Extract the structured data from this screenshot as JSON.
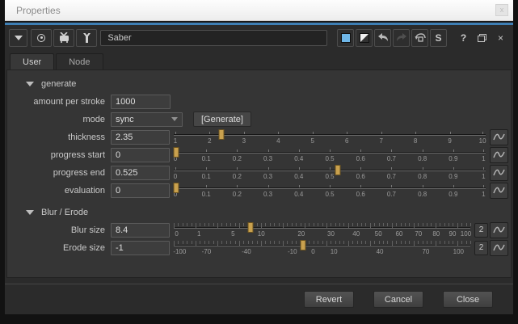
{
  "window": {
    "title": "Properties"
  },
  "toolbar": {
    "node_name": "Saber",
    "s_button_label": "S",
    "help_label": "?",
    "close_label": "×"
  },
  "tabs": {
    "user": "User",
    "node": "Node"
  },
  "generate_section": {
    "title": "generate",
    "amount_label": "amount per stroke",
    "amount_value": "1000",
    "mode_label": "mode",
    "mode_value": "sync",
    "generate_button": "[Generate]",
    "thickness_label": "thickness",
    "thickness_value": "2.35",
    "progress_start_label": "progress start",
    "progress_start_value": "0",
    "progress_end_label": "progress end",
    "progress_end_value": "0.525",
    "evaluation_label": "evaluation",
    "evaluation_value": "0"
  },
  "blur_section": {
    "title": "Blur / Erode",
    "blur_label": "Blur size",
    "blur_value": "8.4",
    "blur_value2": "2",
    "erode_label": "Erode size",
    "erode_value": "-1",
    "erode_value2": "2"
  },
  "footer": {
    "revert": "Revert",
    "cancel": "Cancel",
    "close": "Close"
  },
  "colors": {
    "accent_blue": "#3e7fb5",
    "swatch_blue": "#6fb7e8",
    "slider_handle": "#c9a14e"
  },
  "sliders": {
    "thickness": {
      "ruler": false,
      "handle_pct": 15.4,
      "ticks": [
        {
          "l": "1",
          "p": 0.5
        },
        {
          "l": "2",
          "p": 11.5
        },
        {
          "l": "3",
          "p": 22.5
        },
        {
          "l": "4",
          "p": 33.5
        },
        {
          "l": "5",
          "p": 44.5
        },
        {
          "l": "6",
          "p": 55.5
        },
        {
          "l": "7",
          "p": 66.5
        },
        {
          "l": "8",
          "p": 77.5
        },
        {
          "l": "9",
          "p": 88.5
        },
        {
          "l": "10",
          "p": 99
        }
      ]
    },
    "progress_start": {
      "ruler": false,
      "handle_pct": 0.8,
      "ticks": [
        {
          "l": "0",
          "p": 0.5
        },
        {
          "l": "0.1",
          "p": 10.4
        },
        {
          "l": "0.2",
          "p": 20.3
        },
        {
          "l": "0.3",
          "p": 30.2
        },
        {
          "l": "0.4",
          "p": 40.1
        },
        {
          "l": "0.5",
          "p": 50
        },
        {
          "l": "0.6",
          "p": 59.9
        },
        {
          "l": "0.7",
          "p": 69.8
        },
        {
          "l": "0.8",
          "p": 79.7
        },
        {
          "l": "0.9",
          "p": 89.6
        },
        {
          "l": "1",
          "p": 99.3
        }
      ]
    },
    "progress_end": {
      "ruler": false,
      "handle_pct": 52.5,
      "ticks": [
        {
          "l": "0",
          "p": 0.5
        },
        {
          "l": "0.1",
          "p": 10.4
        },
        {
          "l": "0.2",
          "p": 20.3
        },
        {
          "l": "0.3",
          "p": 30.2
        },
        {
          "l": "0.4",
          "p": 40.1
        },
        {
          "l": "0.5",
          "p": 50
        },
        {
          "l": "0.6",
          "p": 59.9
        },
        {
          "l": "0.7",
          "p": 69.8
        },
        {
          "l": "0.8",
          "p": 79.7
        },
        {
          "l": "0.9",
          "p": 89.6
        },
        {
          "l": "1",
          "p": 99.3
        }
      ]
    },
    "evaluation": {
      "ruler": false,
      "handle_pct": 0.8,
      "ticks": [
        {
          "l": "0",
          "p": 0.5
        },
        {
          "l": "0.1",
          "p": 10.4
        },
        {
          "l": "0.2",
          "p": 20.3
        },
        {
          "l": "0.3",
          "p": 30.2
        },
        {
          "l": "0.4",
          "p": 40.1
        },
        {
          "l": "0.5",
          "p": 50
        },
        {
          "l": "0.6",
          "p": 59.9
        },
        {
          "l": "0.7",
          "p": 69.8
        },
        {
          "l": "0.8",
          "p": 79.7
        },
        {
          "l": "0.9",
          "p": 89.6
        },
        {
          "l": "1",
          "p": 99.3
        }
      ]
    },
    "blur": {
      "ruler": true,
      "handle_pct": 26,
      "ticks": [
        {
          "l": "0",
          "p": 1
        },
        {
          "l": "1",
          "p": 8.5
        },
        {
          "l": "5",
          "p": 20
        },
        {
          "l": "10",
          "p": 29.5
        },
        {
          "l": "20",
          "p": 43
        },
        {
          "l": "30",
          "p": 53
        },
        {
          "l": "40",
          "p": 61.5
        },
        {
          "l": "50",
          "p": 69
        },
        {
          "l": "60",
          "p": 76
        },
        {
          "l": "70",
          "p": 82.5
        },
        {
          "l": "80",
          "p": 88.5
        },
        {
          "l": "90",
          "p": 94
        },
        {
          "l": "100",
          "p": 98.5
        }
      ]
    },
    "erode": {
      "ruler": true,
      "handle_pct": 43.5,
      "ticks": [
        {
          "l": "-100",
          "p": 2
        },
        {
          "l": "-70",
          "p": 11
        },
        {
          "l": "-40",
          "p": 24.5
        },
        {
          "l": "-10",
          "p": 40
        },
        {
          "l": "0",
          "p": 47
        },
        {
          "l": "10",
          "p": 54
        },
        {
          "l": "40",
          "p": 69.5
        },
        {
          "l": "70",
          "p": 85
        },
        {
          "l": "100",
          "p": 96
        }
      ]
    }
  }
}
